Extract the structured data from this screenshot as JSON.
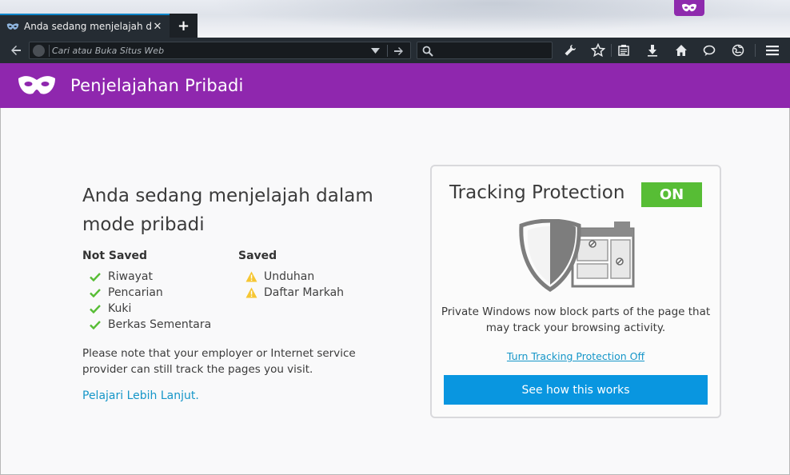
{
  "tab": {
    "title": "Anda sedang menjelajah d...",
    "close": "✕",
    "new_tab": "+"
  },
  "urlbar": {
    "placeholder": "Cari atau Buka Situs Web"
  },
  "header": {
    "title": "Penjelajahan Pribadi"
  },
  "main": {
    "heading": "Anda sedang menjelajah dalam mode pribadi",
    "not_saved": {
      "title": "Not Saved",
      "items": [
        "Riwayat",
        "Pencarian",
        "Kuki",
        "Berkas Sementara"
      ]
    },
    "saved": {
      "title": "Saved",
      "items": [
        "Unduhan",
        "Daftar Markah"
      ]
    },
    "note": "Please note that your employer or Internet service provider can still track the pages you visit.",
    "learn_more": "Pelajari Lebih Lanjut."
  },
  "tracking_protection": {
    "title": "Tracking Protection",
    "status": "ON",
    "description": "Private Windows now block parts of the page that may track your browsing activity.",
    "turn_off_link": "Turn Tracking Protection Off",
    "how_button": "See how this works"
  },
  "colors": {
    "accent_purple": "#8f27ae",
    "status_green": "#57bd35",
    "link_blue": "#1596c8",
    "button_blue": "#0996e0",
    "toolbar_dark": "#252c33"
  },
  "icons": [
    "private-mask-icon",
    "back-arrow-icon",
    "site-identity-icon",
    "dropdown-icon",
    "go-arrow-icon",
    "search-icon",
    "wrench-icon",
    "star-icon",
    "reading-list-icon",
    "download-icon",
    "home-icon",
    "chat-icon",
    "globe-icon",
    "hamburger-menu-icon",
    "check-icon",
    "warning-icon",
    "shield-illustration"
  ]
}
